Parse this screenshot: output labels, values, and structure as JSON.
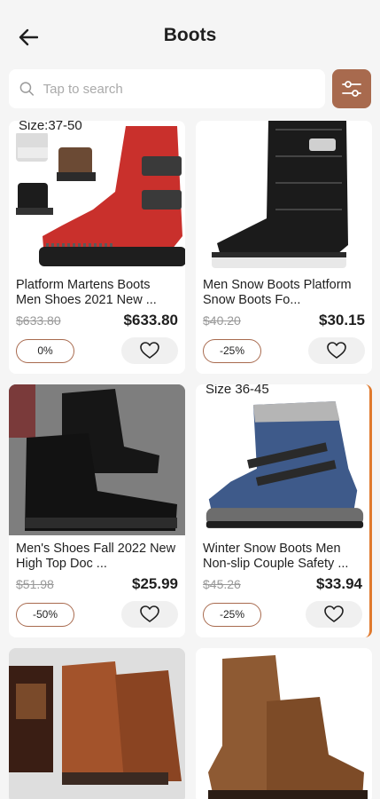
{
  "header": {
    "title": "Boots",
    "back_icon": "arrow-left-icon"
  },
  "search": {
    "placeholder": "Tap to search",
    "value": "",
    "icon": "search-icon",
    "filter_icon": "sliders-icon"
  },
  "colors": {
    "accent": "#a86a4e",
    "background": "#f5f5f5",
    "card": "#ffffff"
  },
  "products": [
    {
      "image_caption": "Size:37-50",
      "name": "Platform Martens Boots Men Shoes 2021 New ...",
      "old_price": "$633.80",
      "price": "$633.80",
      "discount": "0%"
    },
    {
      "image_caption": "",
      "name": "Men Snow Boots Platform Snow Boots Fo...",
      "old_price": "$40.20",
      "price": "$30.15",
      "discount": "-25%"
    },
    {
      "image_caption": "",
      "name": "Men's Shoes Fall 2022 New High Top Doc ...",
      "old_price": "$51.98",
      "price": "$25.99",
      "discount": "-50%"
    },
    {
      "image_caption": "Size 36-45",
      "name": "Winter Snow Boots Men Non-slip Couple Safety ...",
      "old_price": "$45.26",
      "price": "$33.94",
      "discount": "-25%"
    },
    {
      "image_caption": "",
      "name": "",
      "old_price": "",
      "price": "",
      "discount": ""
    },
    {
      "image_caption": "",
      "name": "",
      "old_price": "",
      "price": "",
      "discount": ""
    }
  ]
}
